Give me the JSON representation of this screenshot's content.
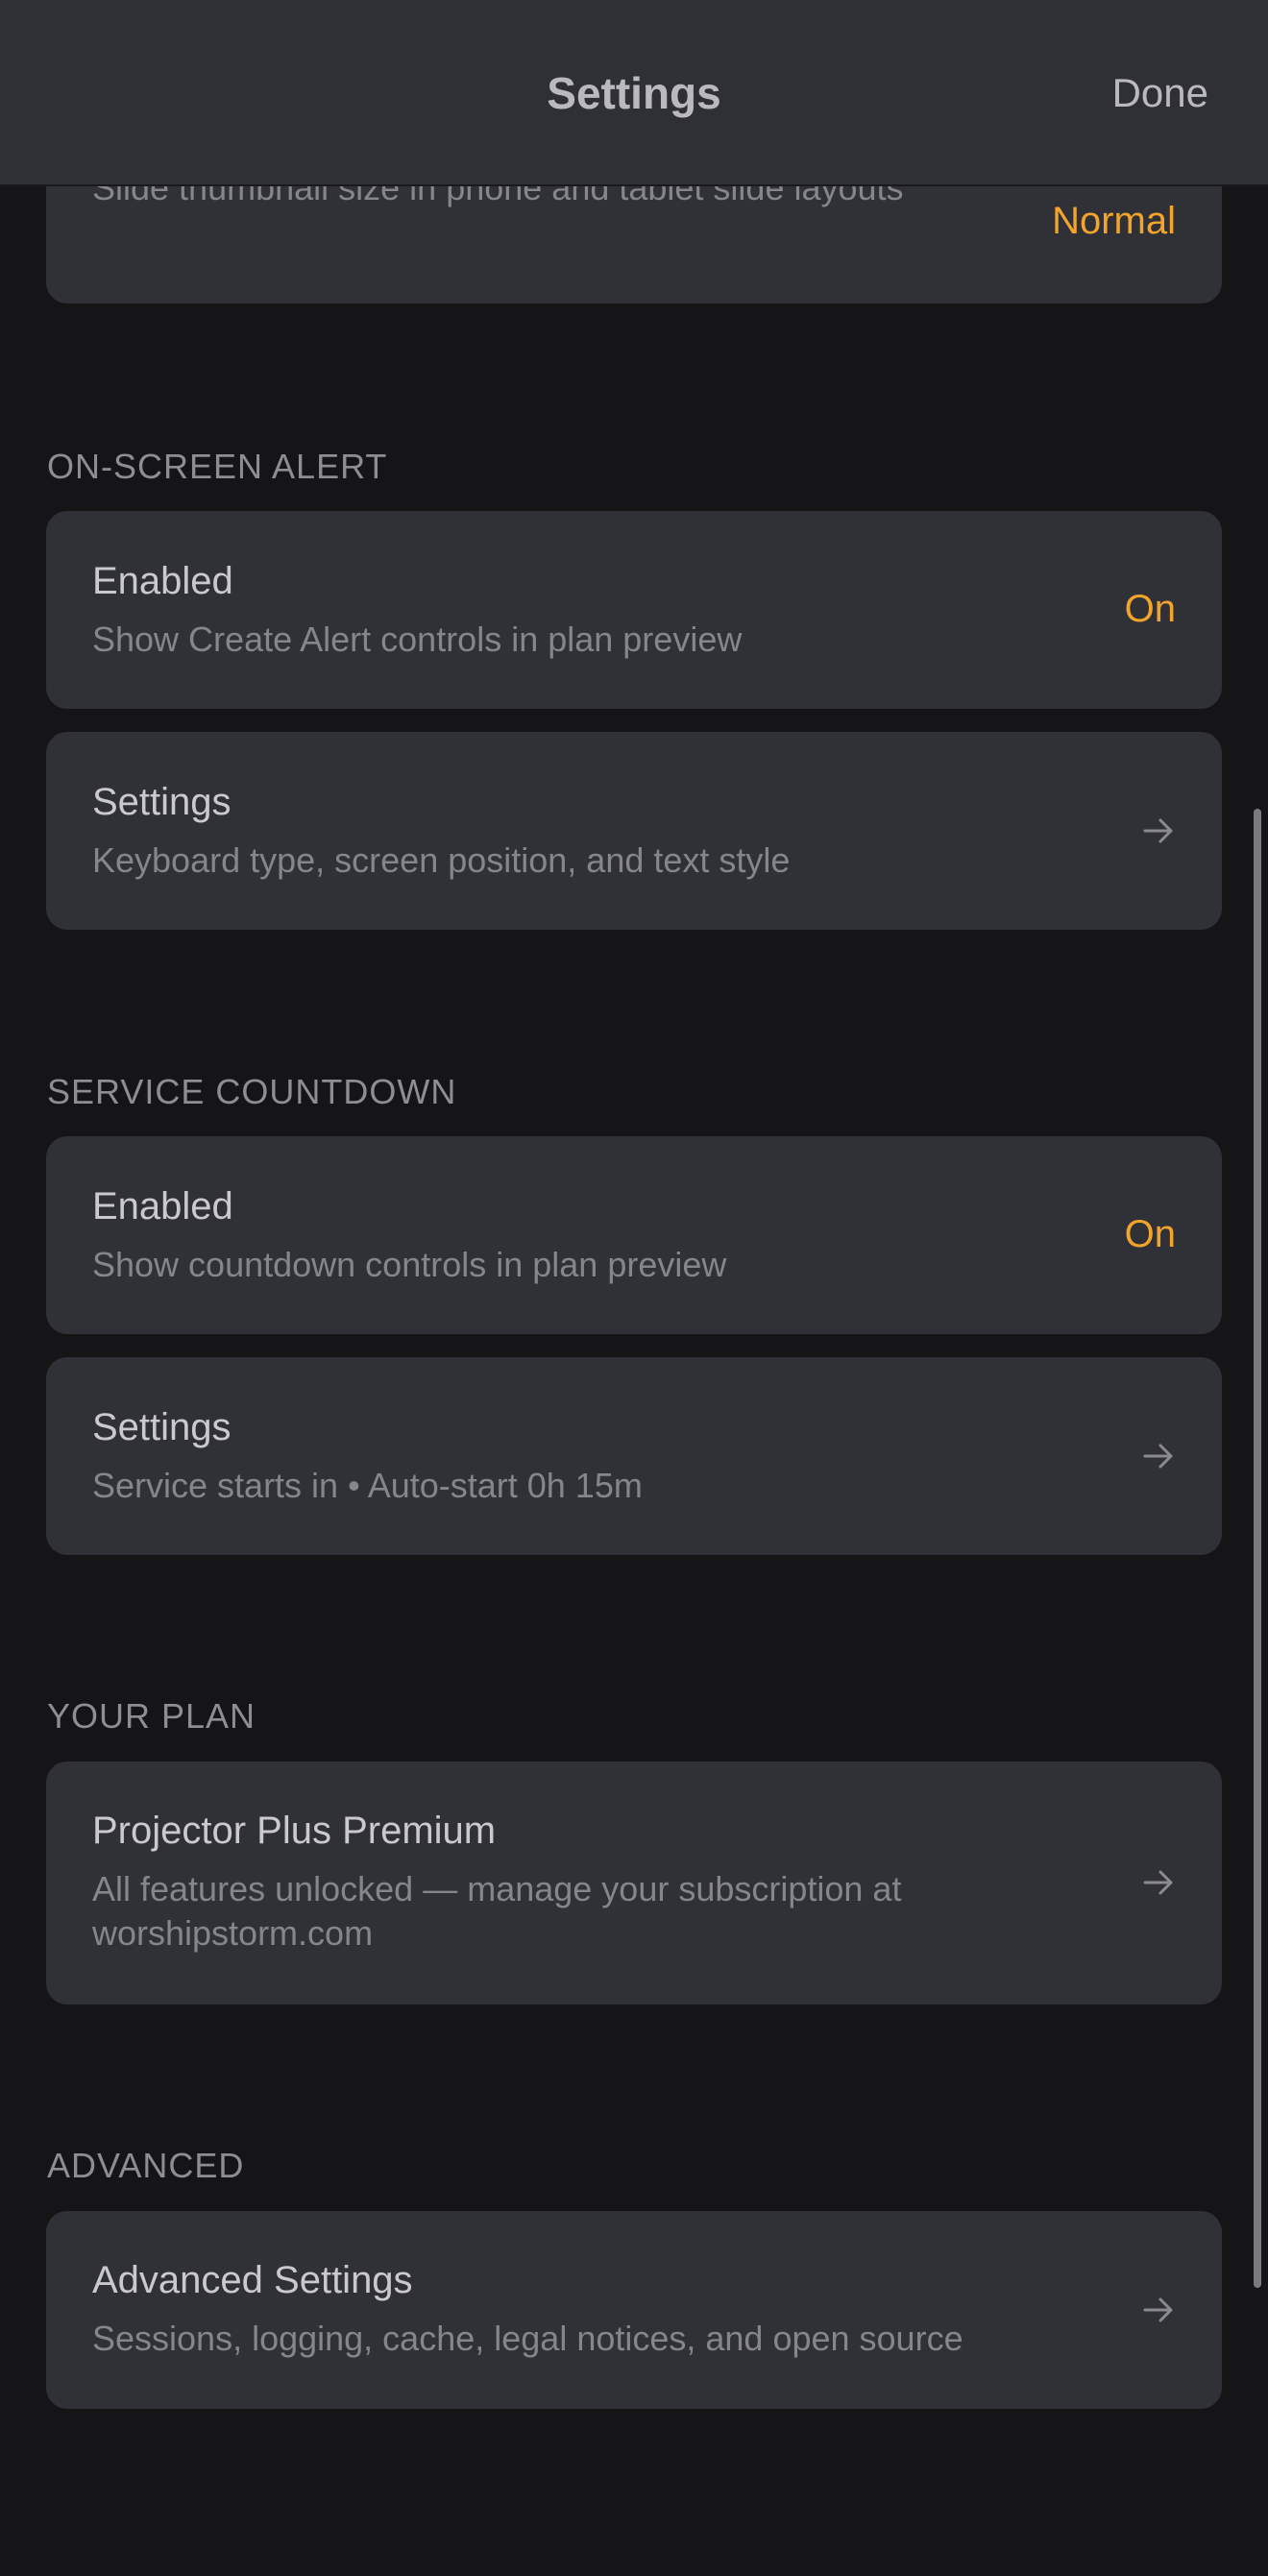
{
  "nav": {
    "title": "Settings",
    "done_label": "Done"
  },
  "thumbnail_card": {
    "subtitle": "Slide thumbnail size in phone and tablet slide layouts",
    "value": "Normal"
  },
  "on_screen_alert": {
    "header": "ON-SCREEN ALERT",
    "enabled": {
      "title": "Enabled",
      "subtitle": "Show Create Alert controls in plan preview",
      "value": "On"
    },
    "settings": {
      "title": "Settings",
      "subtitle": "Keyboard type, screen position, and text style"
    }
  },
  "service_countdown": {
    "header": "SERVICE COUNTDOWN",
    "enabled": {
      "title": "Enabled",
      "subtitle": "Show countdown controls in plan preview",
      "value": "On"
    },
    "settings": {
      "title": "Settings",
      "subtitle": "Service starts in • Auto-start 0h 15m"
    }
  },
  "your_plan": {
    "header": "YOUR PLAN",
    "plan": {
      "title": "Projector Plus Premium",
      "subtitle": "All features unlocked — manage your subscription at worshipstorm.com"
    }
  },
  "advanced": {
    "header": "ADVANCED",
    "settings": {
      "title": "Advanced Settings",
      "subtitle": "Sessions, logging, cache, legal notices, and open source"
    }
  },
  "colors": {
    "background": "#151517",
    "card": "#303037",
    "accent": "#f2a42c",
    "navbar": "#2f2f36"
  },
  "icons": {
    "row_arrow": "arrow-right-icon"
  }
}
